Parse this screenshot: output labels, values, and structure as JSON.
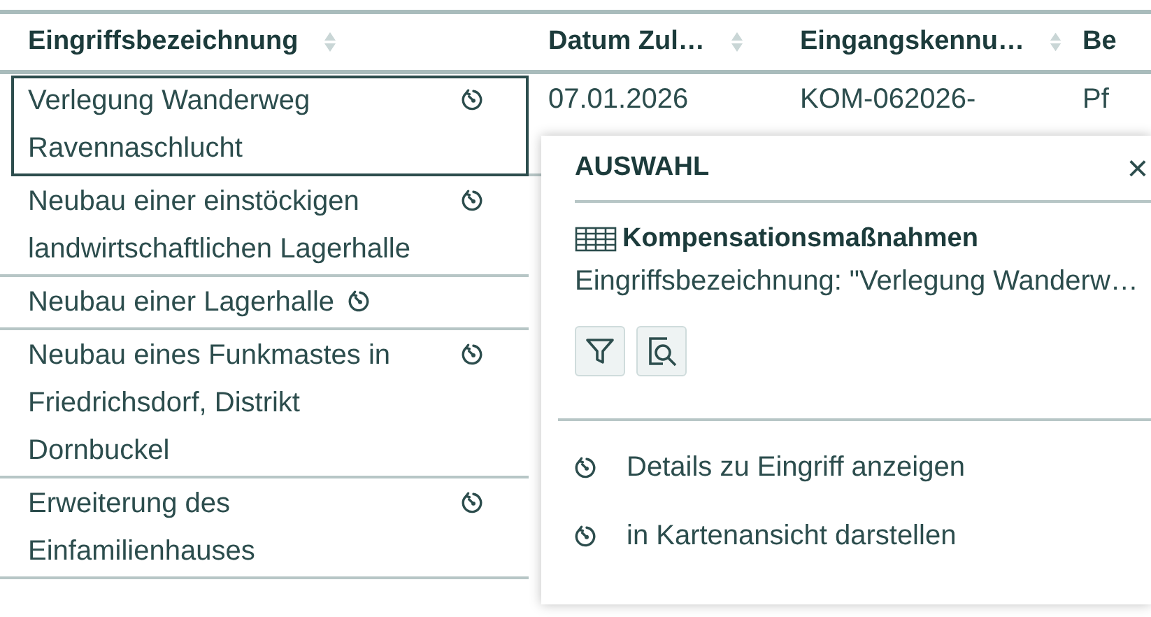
{
  "table": {
    "columns": [
      {
        "label": "Eingriffsbezeichnung",
        "sortable": true
      },
      {
        "label": "Datum Zul…",
        "sortable": true
      },
      {
        "label": "Eingangskennu…",
        "sortable": true
      },
      {
        "label": "Be"
      }
    ],
    "rows": [
      {
        "selected": true,
        "cells": [
          "Verlegung Wanderweg Ravennaschlucht",
          "07.01.2026",
          "KOM-062026-",
          "Pf"
        ]
      },
      {
        "selected": false,
        "cells": [
          "Neubau einer einstöckigen landwirtschaftlichen Lagerhalle"
        ]
      },
      {
        "selected": false,
        "cells": [
          "Neubau einer Lagerhalle"
        ]
      },
      {
        "selected": false,
        "cells": [
          "Neubau eines Funkmastes in Friedrichsdorf, Distrikt Dornbuckel"
        ]
      },
      {
        "selected": false,
        "cells": [
          "Erweiterung des Einfamilienhauses"
        ]
      }
    ]
  },
  "popup": {
    "title": "AUSWAHL",
    "close": "×",
    "heading": "Kompensationsmaßnahmen",
    "subtitle": "Eingriffsbezeichnung: \"Verlegung Wanderw…",
    "actions": [
      {
        "kind": "filter"
      },
      {
        "kind": "preview"
      }
    ],
    "menu": [
      "Details zu Eingriff anzeigen",
      "in Kartenansicht darstellen"
    ]
  }
}
